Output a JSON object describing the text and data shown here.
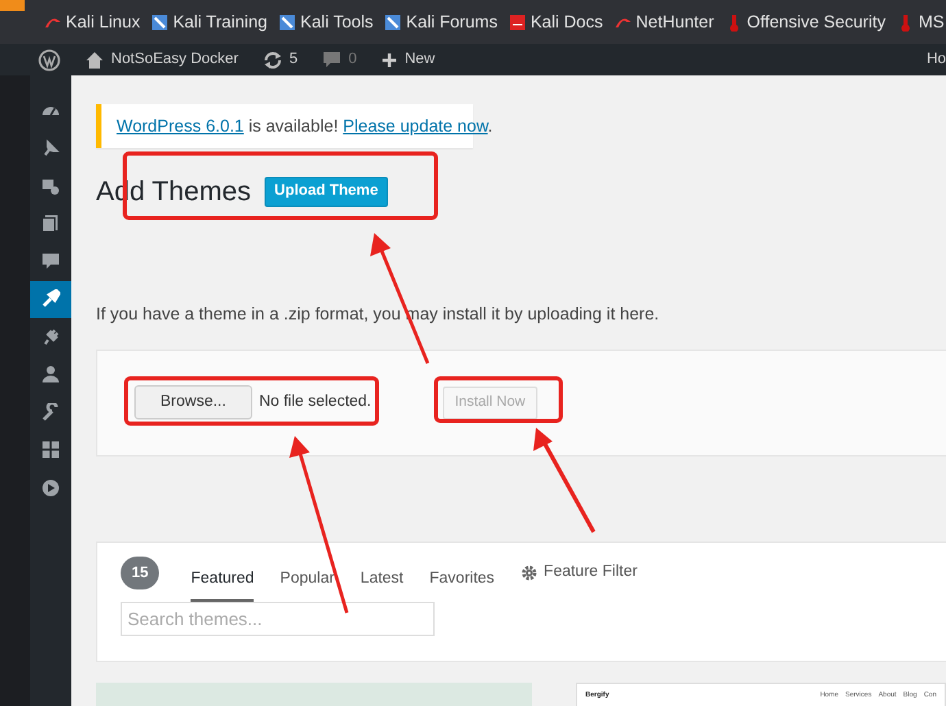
{
  "bookmarks": [
    {
      "label": "Kali Linux"
    },
    {
      "label": "Kali Training"
    },
    {
      "label": "Kali Tools"
    },
    {
      "label": "Kali Forums"
    },
    {
      "label": "Kali Docs"
    },
    {
      "label": "NetHunter"
    },
    {
      "label": "Offensive Security"
    },
    {
      "label": "MS"
    }
  ],
  "admin_bar": {
    "site": "NotSoEasy Docker",
    "updates": "5",
    "comments": "0",
    "new": "New",
    "account": "Ho"
  },
  "sidebar": {
    "items": [
      {
        "selected": false
      },
      {
        "selected": false
      },
      {
        "selected": false
      },
      {
        "selected": false
      },
      {
        "selected": false
      },
      {
        "selected": true
      },
      {
        "selected": false
      },
      {
        "selected": false
      },
      {
        "selected": false
      },
      {
        "selected": false
      },
      {
        "selected": false
      }
    ]
  },
  "notice": {
    "link": "WordPress 6.0.1",
    "text": " is available! ",
    "action": "Please update now",
    "end": "."
  },
  "heading": "Add Themes",
  "upload_button": "Upload Theme",
  "help_text": "If you have a theme in a .zip format, you may install it by uploading it here.",
  "upload_form": {
    "browse": "Browse...",
    "file_status": "No file selected.",
    "install": "Install Now",
    "install_disabled": true
  },
  "filter": {
    "count": "15",
    "tabs": [
      {
        "label": "Featured",
        "selected": true
      },
      {
        "label": "Popular",
        "selected": false
      },
      {
        "label": "Latest",
        "selected": false
      },
      {
        "label": "Favorites",
        "selected": false
      }
    ],
    "feature_filter": "Feature Filter",
    "search_placeholder": "Search themes..."
  },
  "preview": {
    "name": "Bergify",
    "nav": [
      "Home",
      "Services",
      "About",
      "Blog",
      "Con"
    ]
  }
}
